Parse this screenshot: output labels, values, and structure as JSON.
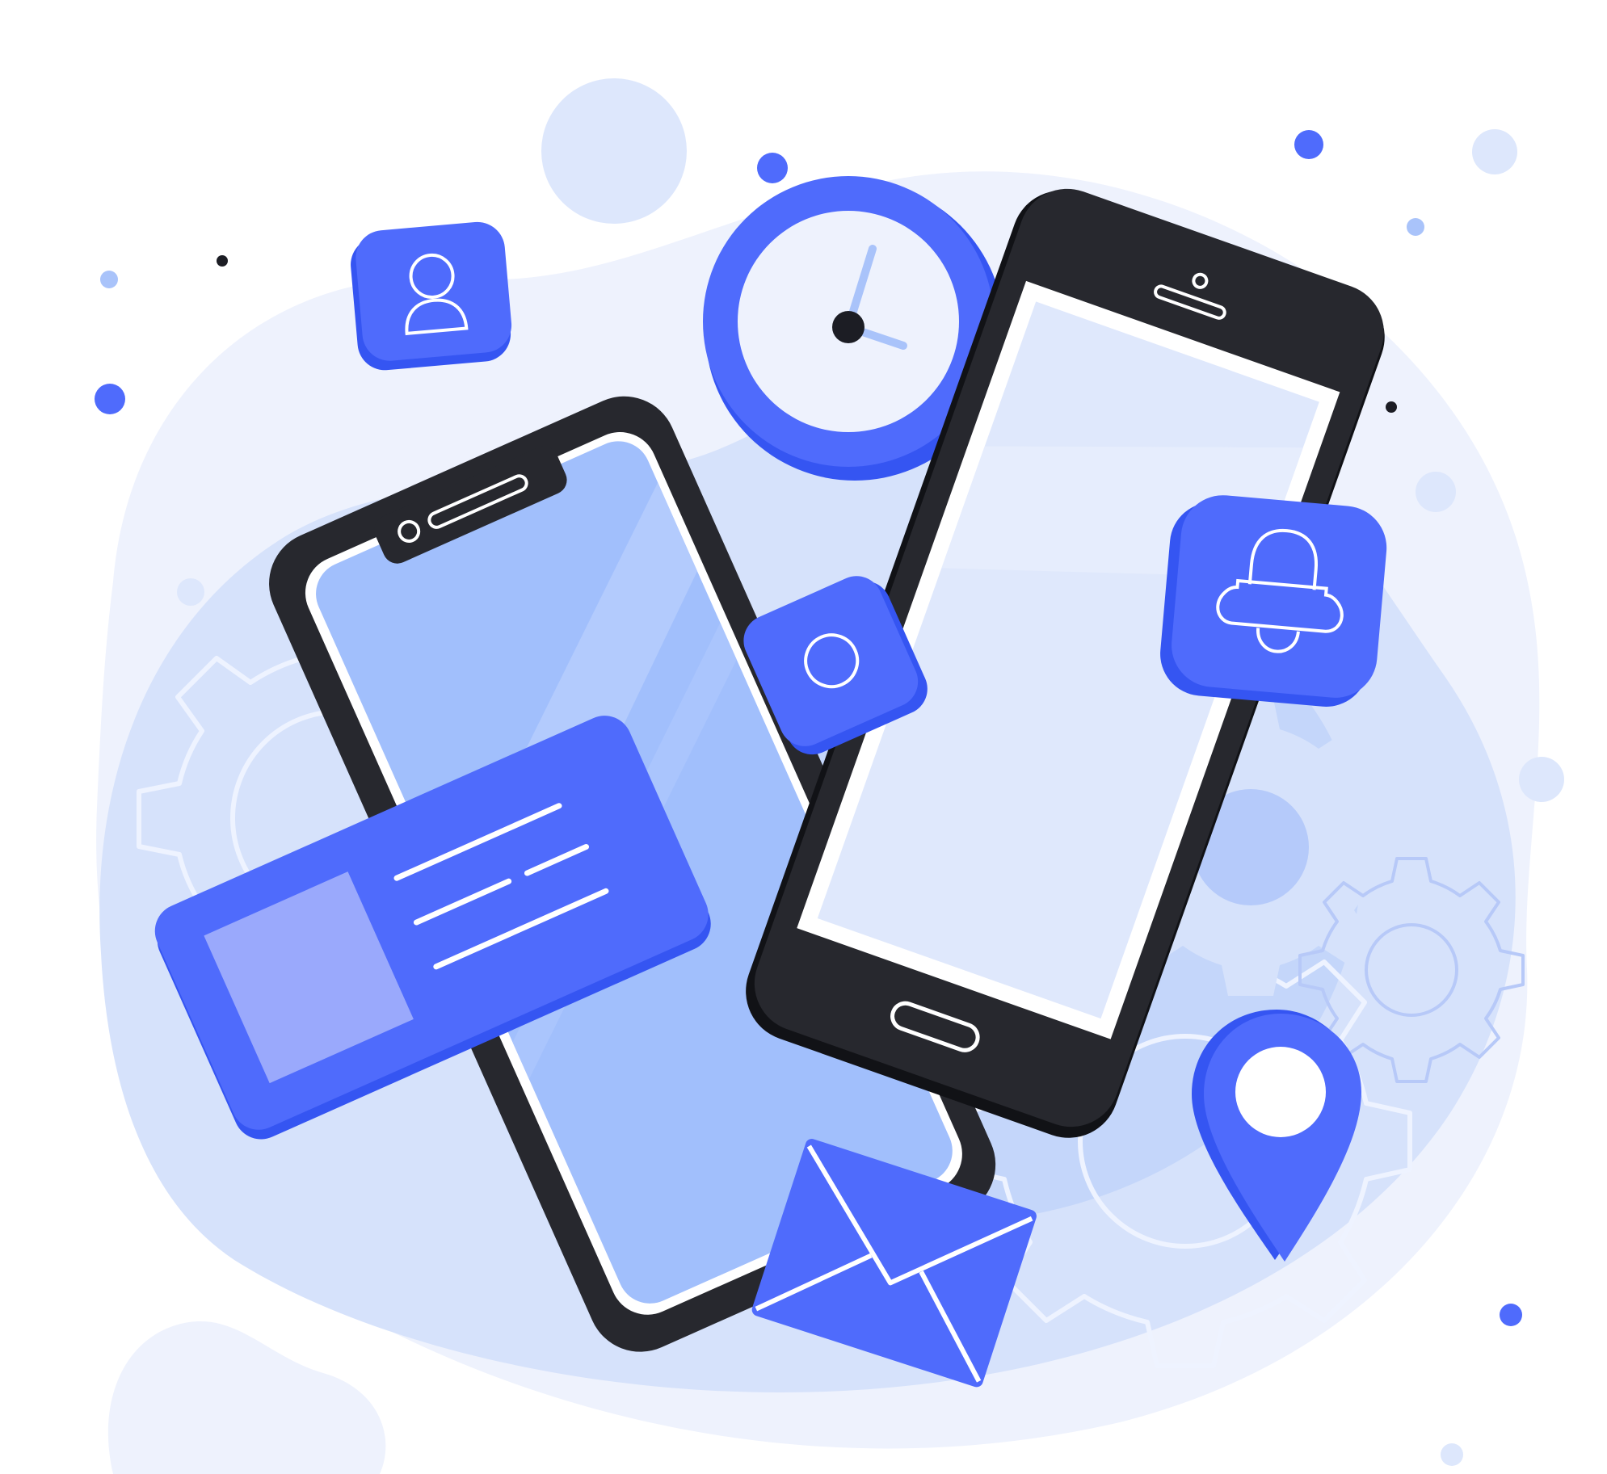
{
  "scene": {
    "description_free": true,
    "colors": {
      "background": "#ffffff",
      "blob_light": "#eef2fd",
      "blob_mid": "#d6e2fb",
      "blob_deep": "#c4d6fa",
      "accent_blue": "#4f6bfc",
      "accent_blue_dark": "#3555f2",
      "phone_body": "#27282e",
      "phone_body_edge": "#111216",
      "screen_left": "#a1bffc",
      "screen_right": "#dfe8fc",
      "image_placeholder": "#9aa9fc",
      "gear_stroke": "#eef3ff",
      "dot_dark": "#1c1d24",
      "dot_light": "#a9c3fa",
      "dot_pale": "#dde7fc"
    },
    "icons": [
      "user-icon",
      "clock-icon",
      "camera-icon",
      "bell-icon",
      "location-pin-icon",
      "envelope-icon",
      "image-card-icon",
      "gear-icon"
    ]
  }
}
